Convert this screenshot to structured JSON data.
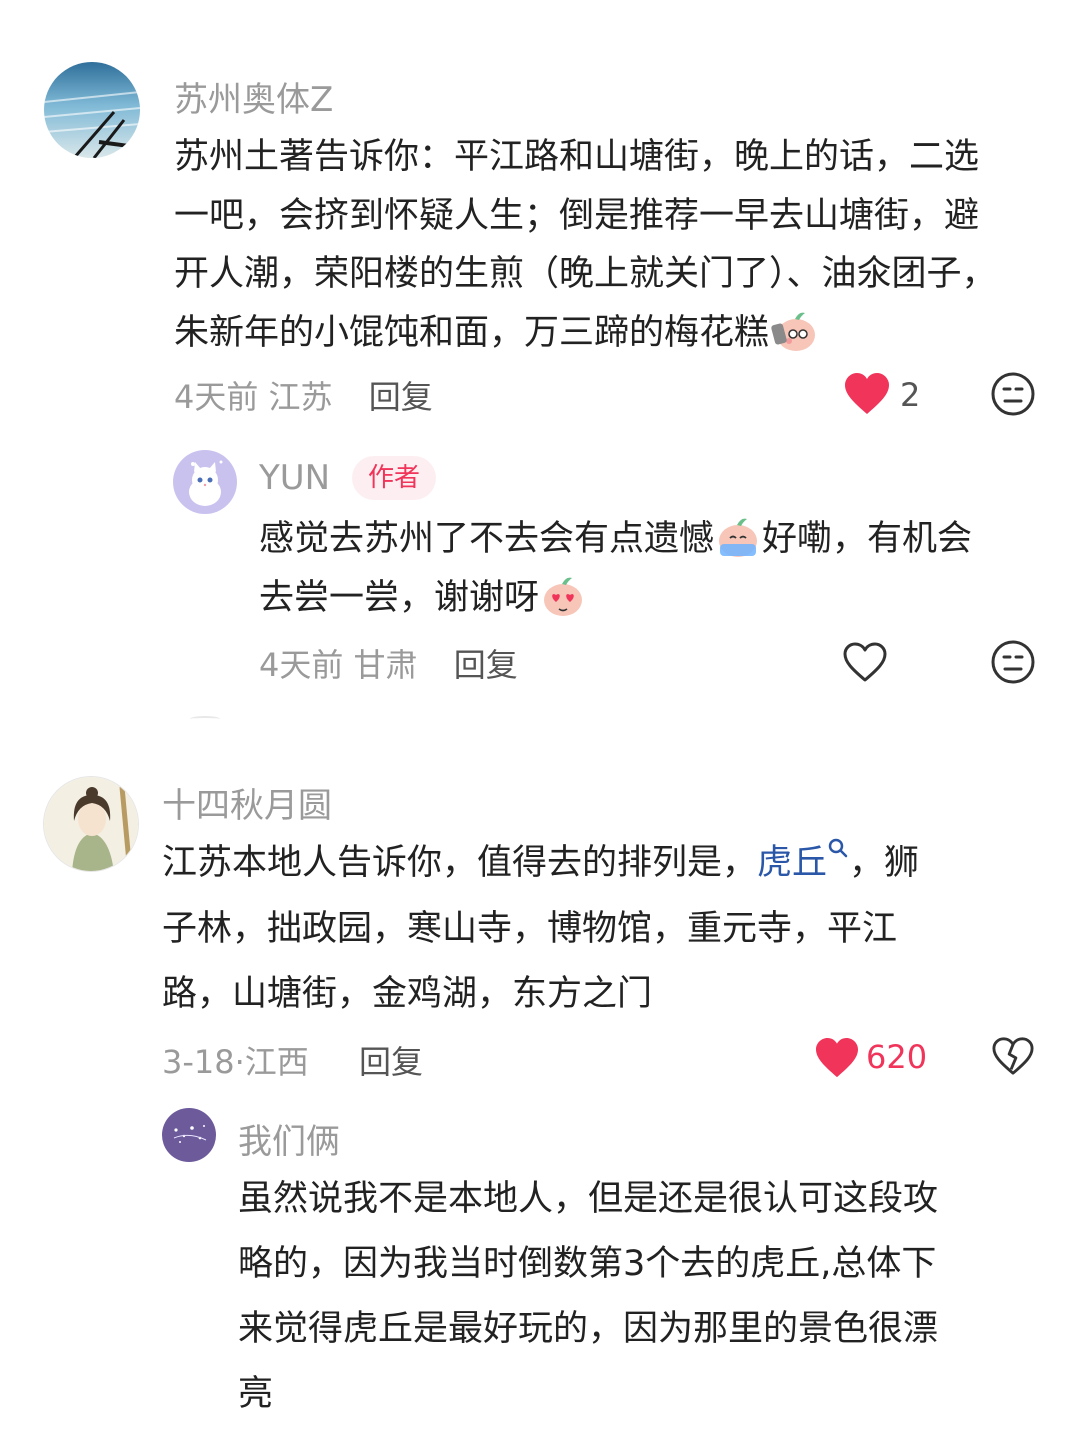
{
  "comments": [
    {
      "user": "苏州奥体Z",
      "lines": [
        "苏州土著告诉你：平江路和山塘街，晚上的话，二选",
        "一吧，会挤到怀疑人生；倒是推荐一早去山塘街，避",
        "开人潮，荣阳楼的生煎（晚上就关门了）、油氽团子，",
        "朱新年的小馄饨和面，万三蹄的梅花糕"
      ],
      "time": "4天前",
      "location": "江苏",
      "reply_label": "回复",
      "likes": "2",
      "liked": true,
      "replies": [
        {
          "user": "YUN",
          "badge": "作者",
          "line1_a": "感觉去苏州了不去会有点遗憾",
          "line1_b": "好嘞，有机会",
          "line2": "去尝一尝，谢谢呀",
          "time": "4天前",
          "location": "甘肃",
          "reply_label": "回复",
          "liked": false
        }
      ]
    },
    {
      "user": "十四秋月圆",
      "line1_a": "江苏本地人告诉你，值得去的排列是，",
      "line1_link": "虎丘",
      "line1_b": "，狮",
      "line2": "子林，拙政园，寒山寺，博物馆，重元寺，平江",
      "line3": "路，山塘街，金鸡湖，东方之门",
      "time": "3-18·",
      "location": "江西",
      "reply_label": "回复",
      "likes": "620",
      "liked": true,
      "replies": [
        {
          "user": "我们俩",
          "lines": [
            "虽然说我不是本地人，但是还是很认可这段攻",
            "略的，因为我当时倒数第3个去的虎丘,总体下",
            "来觉得虎丘是最好玩的，因为那里的景色很漂",
            "亮"
          ]
        }
      ]
    }
  ],
  "colors": {
    "like_red": "#f0345a",
    "meta_gray": "#9a9a9a",
    "link_blue": "#2b57a8",
    "badge_bg": "#fdeff1"
  },
  "icons": [
    "heart-filled-icon",
    "heart-outline-icon",
    "dislike-face-icon",
    "broken-heart-icon",
    "search-icon"
  ]
}
